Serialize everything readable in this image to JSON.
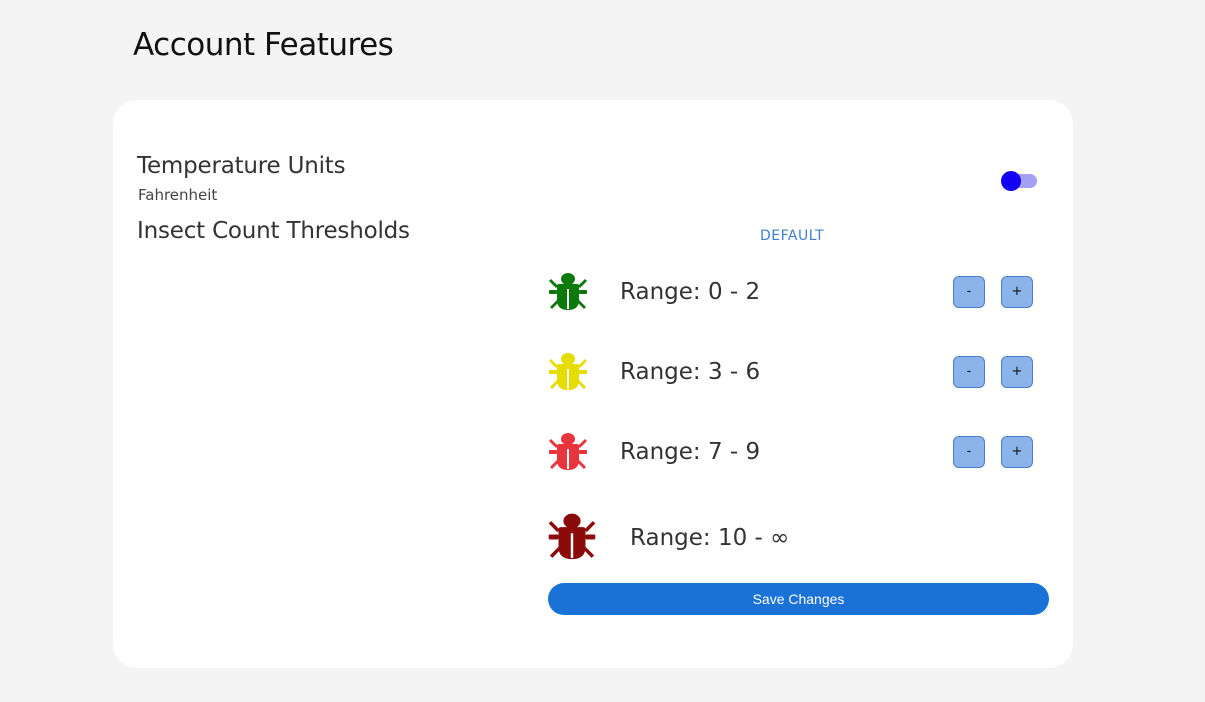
{
  "page": {
    "title": "Account Features"
  },
  "temperature": {
    "heading": "Temperature Units",
    "current_unit": "Fahrenheit",
    "toggle_on": false
  },
  "insect_thresholds": {
    "heading": "Insect Count Thresholds",
    "default_label": "DEFAULT",
    "ranges": [
      {
        "label": "Range: 0 - 2",
        "icon": "bug-icon",
        "color": "#0b7a0b",
        "minus_label": "-",
        "plus_label": "+"
      },
      {
        "label": "Range: 3 - 6",
        "icon": "bug-icon",
        "color": "#e6dc00",
        "minus_label": "-",
        "plus_label": "+"
      },
      {
        "label": "Range: 7 - 9",
        "icon": "bug-icon",
        "color": "#e8353d",
        "minus_label": "-",
        "plus_label": "+"
      },
      {
        "label": "Range: 10 - ∞",
        "icon": "bug-icon",
        "color": "#8b0a0a"
      }
    ]
  },
  "actions": {
    "save_label": "Save Changes"
  },
  "colors": {
    "background": "#f4f4f4",
    "card": "#ffffff",
    "accent": "#1a72d6",
    "toggle_thumb": "#1400f0",
    "toggle_track": "#a4a0f6",
    "stepper_button": "#8ab4ea",
    "link": "#3f7fd0"
  }
}
